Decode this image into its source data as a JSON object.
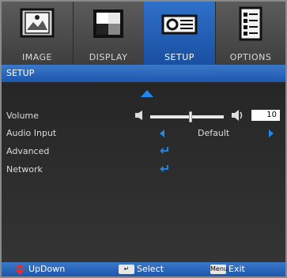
{
  "tabs": [
    {
      "label": "IMAGE",
      "icon": "image-icon"
    },
    {
      "label": "DISPLAY",
      "icon": "display-icon"
    },
    {
      "label": "SETUP",
      "icon": "projector-icon",
      "active": true
    },
    {
      "label": "OPTIONS",
      "icon": "options-icon"
    }
  ],
  "section_title": "SETUP",
  "menu": {
    "volume_label": "Volume",
    "volume_value": "10",
    "volume_level": 0.55,
    "audio_input_label": "Audio Input",
    "audio_input_value": "Default",
    "advanced_label": "Advanced",
    "network_label": "Network"
  },
  "footer": {
    "updown_label": "UpDown",
    "select_label": "Select",
    "menu_key": "Menu",
    "exit_label": "Exit"
  },
  "colors": {
    "accent": "#1e8af0",
    "header_blue": "#2f71c9"
  }
}
